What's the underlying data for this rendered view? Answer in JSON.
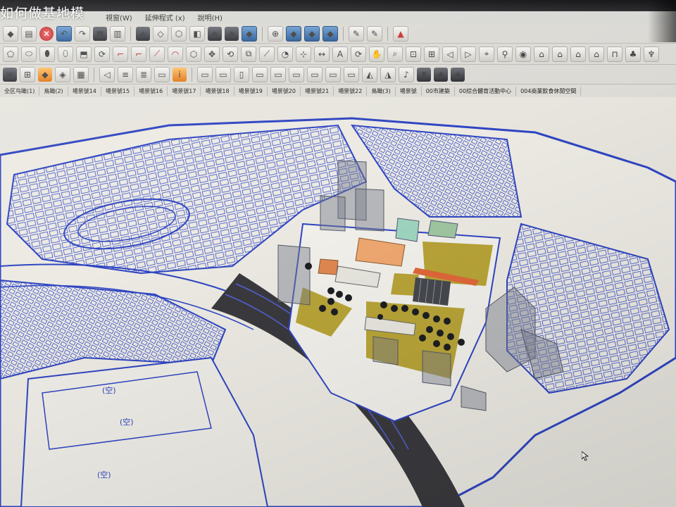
{
  "overlay": {
    "title": "如何做基地模"
  },
  "menu": {
    "items": [
      "視窗(W)",
      "延伸程式 (x)",
      "說明(H)"
    ]
  },
  "toolbar": {
    "row1": [
      "gem-icon",
      "clipboard-icon",
      "delete-icon",
      "undo-icon",
      "redo-icon",
      "print-icon",
      "model-info-icon",
      "cube-iso-icon",
      "cube-top-icon",
      "cube-front-icon",
      "cube-right-icon",
      "cube-back-icon",
      "cube-left-icon",
      "cube-shaded-icon",
      "cube-textured-icon",
      "cube-xray-icon",
      "orbit-icon",
      "section-icon",
      "section-plane-icon",
      "section-fill-icon",
      "section-cut-icon",
      "pencil-icon",
      "eraser-icon",
      "warehouse-icon"
    ],
    "row2": [
      "select-icon",
      "eraser-tool-icon",
      "paint-icon",
      "offset-icon",
      "push-pull-icon",
      "follow-me-icon",
      "line-icon",
      "arc-icon",
      "rectangle-icon",
      "circle-icon",
      "polygon-icon",
      "move-icon",
      "rotate-icon",
      "scale-icon",
      "tape-icon",
      "protractor-icon",
      "axes-icon",
      "dimension-icon",
      "text-icon",
      "orbit-tool-icon",
      "pan-icon",
      "zoom-icon",
      "zoom-window-icon",
      "zoom-extents-icon",
      "prev-view-icon",
      "next-view-icon",
      "position-camera-icon",
      "walk-icon",
      "look-around-icon",
      "house-icon",
      "shop-icon",
      "home-icon",
      "home-alt-icon",
      "bench-icon",
      "tree-icon",
      "lamp-icon"
    ],
    "row3": [
      "camera-icon",
      "mesh-icon",
      "solid-icon",
      "sandbox-icon",
      "grid-icon",
      "speaker-icon",
      "ruler-icon",
      "layers-icon",
      "chat-icon",
      "info-icon",
      "panel-icon",
      "wall-icon",
      "door-icon",
      "window-icon",
      "stair-icon",
      "roof-icon",
      "column-icon",
      "beam-icon",
      "slab-icon",
      "triangle-icon",
      "triangle-alt-icon",
      "note-icon",
      "measure-icon",
      "boxes-icon",
      "cubes-icon"
    ]
  },
  "scenes": {
    "tabs": [
      "全区鸟瞰(1)",
      "鳥瞰(2)",
      "場景號14",
      "場景號15",
      "場景號16",
      "場景號17",
      "場景號18",
      "場景號19",
      "場景號20",
      "場景號21",
      "場景號22",
      "鳥瞰(3)",
      "場景號",
      "00市建築",
      "00綜合體育活動中心",
      "004商業飲食休閒空間"
    ]
  },
  "site": {
    "labels": [
      "(空)",
      "(空)",
      "(空)"
    ]
  },
  "colors": {
    "linework": "#2f45c2",
    "road": "#3a3a3e",
    "lawn": "#b8a437",
    "orange_block": "#f0a870",
    "accent_orange": "#e0673a"
  }
}
